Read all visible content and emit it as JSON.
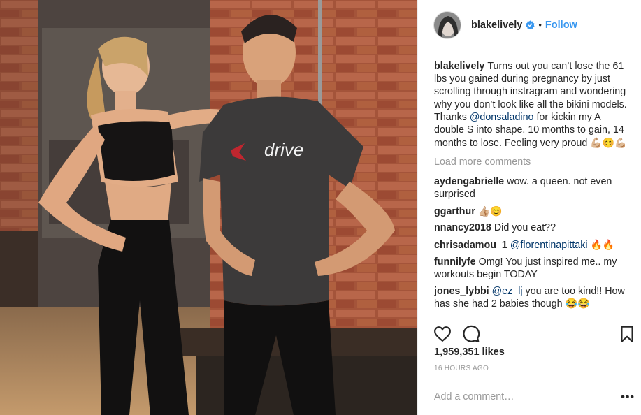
{
  "post": {
    "username": "blakelively",
    "follow_label": "Follow",
    "dot": "•",
    "caption": "Turns out you can’t lose the 61 lbs you gained during pregnancy by just scrolling through instragram and wondering why you don’t look like all the bikini models. Thanks ",
    "caption_mention": "@donsaladino",
    "caption_end": " for kickin my A double S into shape. 10 months to gain, 14 months to lose. Feeling very proud ",
    "caption_emoji": "💪🏼😊💪🏼",
    "shirt_text": "drive"
  },
  "load_more": "Load more comments",
  "comments": [
    {
      "user": "aydengabrielle",
      "text": "wow. a queen. not even surprised"
    },
    {
      "user": "ggarthur",
      "text": "👍🏼😊"
    },
    {
      "user": "nnancy2018",
      "text": "Did you eat??"
    },
    {
      "user": "chrisadamou_1",
      "mention": "@florentinapittaki",
      "text": " 🔥🔥"
    },
    {
      "user": "funnilyfe",
      "text": "Omg! You just inspired me.. my workouts begin TODAY"
    },
    {
      "user": "jones_lybbi",
      "mention": "@ez_lj",
      "text": " you are too kind!! How has she had 2 babies though 😂😂"
    }
  ],
  "likes": "1,959,351 likes",
  "time": "16 HOURS AGO",
  "add_comment_placeholder": "Add a comment…",
  "more_label": "•••",
  "icons": [
    "verified-badge-icon",
    "heart-icon",
    "comment-icon",
    "bookmark-icon",
    "more-options-icon"
  ],
  "colors": {
    "accent": "#3897f0",
    "mention": "#003569",
    "muted": "#999999"
  }
}
